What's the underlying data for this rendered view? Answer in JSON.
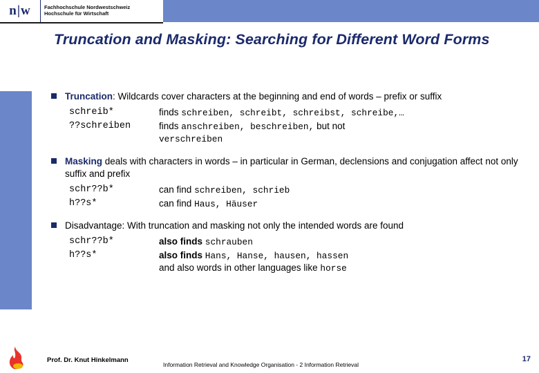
{
  "header": {
    "logo_abbrev": "n|w",
    "logo_lines": [
      "Fachhochschule Nordwestschweiz",
      "Hochschule für Wirtschaft"
    ]
  },
  "slide": {
    "title": "Truncation and Masking: Searching for Different Word Forms",
    "bullets": [
      {
        "lead": "Truncation",
        "rest": ": Wildcards cover characters at the beginning and end of words – prefix or suffix",
        "examples": [
          {
            "term": "schreib*",
            "label": "finds",
            "value": "schreiben, schreibt, schreibst, schreibe,…",
            "label2": "",
            "value2": ""
          },
          {
            "term": "??schreiben",
            "label": "finds",
            "value": "anschreiben, beschreiben,",
            "label2": "but not",
            "value2": "verschreiben"
          }
        ]
      },
      {
        "lead": "Masking",
        "rest": " deals with characters in words – in particular in German, declensions and conjugation affect not only suffix and prefix",
        "examples": [
          {
            "term": "schr??b*",
            "label": "can find",
            "value": "schreiben, schrieb",
            "label2": "",
            "value2": ""
          },
          {
            "term": "h??s*",
            "label": "can find",
            "value": "Haus, Häuser",
            "label2": "",
            "value2": ""
          }
        ]
      },
      {
        "lead": "",
        "rest": "Disadvantage: With truncation and masking not only the intended words are found",
        "examples": [
          {
            "term": "schr??b*",
            "label": "also finds",
            "value": "schrauben",
            "label2": "",
            "value2": ""
          },
          {
            "term": "h??s*",
            "label": "also finds",
            "value": "Hans, Hanse, hausen, hassen",
            "label2": "and also words in other languages like",
            "value2": "horse"
          }
        ]
      }
    ]
  },
  "footer": {
    "author": "Prof. Dr. Knut Hinkelmann",
    "center": "Information Retrieval and Knowledge Organisation - 2 Information Retrieval",
    "page": "17"
  },
  "colors": {
    "banner": "#6b86c9",
    "navy": "#1b2a6b",
    "bullet_marker": "#1b2a6b"
  }
}
